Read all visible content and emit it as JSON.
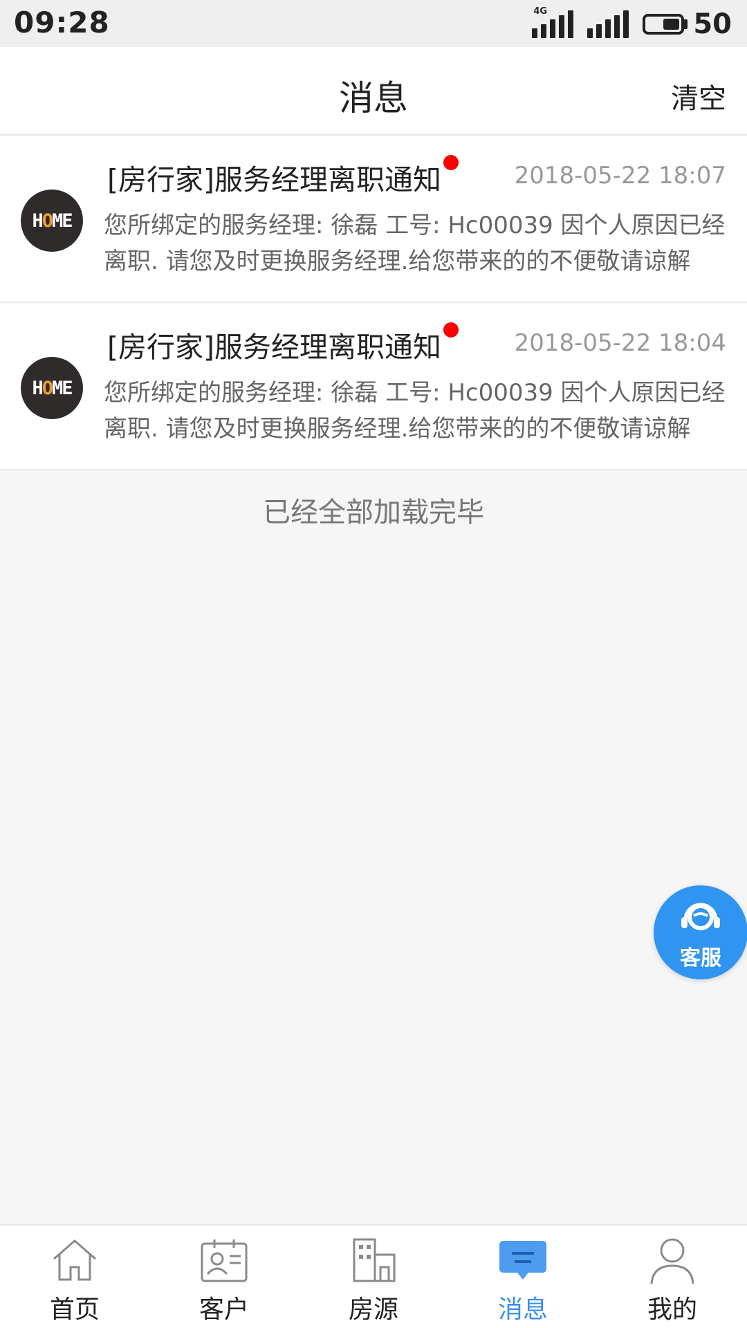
{
  "status_bar": {
    "time": "09:28",
    "network": "4G",
    "battery": "50"
  },
  "header": {
    "title": "消息",
    "clear_label": "清空"
  },
  "messages": [
    {
      "title": "[房行家]服务经理离职通知",
      "time": "2018-05-22 18:07",
      "body": "您所绑定的服务经理: 徐磊 工号: Hc00039 因个人原因已经离职. 请您及时更换服务经理.给您带来的的不便敬请谅解",
      "unread": true,
      "avatar_text": "HOME"
    },
    {
      "title": "[房行家]服务经理离职通知",
      "time": "2018-05-22 18:04",
      "body": "您所绑定的服务经理: 徐磊 工号: Hc00039 因个人原因已经离职. 请您及时更换服务经理.给您带来的的不便敬请谅解",
      "unread": true,
      "avatar_text": "HOME"
    }
  ],
  "list_footer": "已经全部加载完毕",
  "service_button": {
    "label": "客服",
    "icon": "headset-icon"
  },
  "bottom_nav": {
    "active": "消息",
    "active_color": "#3a8fe8",
    "tabs": [
      {
        "label": "首页",
        "icon": "home-icon"
      },
      {
        "label": "客户",
        "icon": "contact-card-icon"
      },
      {
        "label": "房源",
        "icon": "building-icon"
      },
      {
        "label": "消息",
        "icon": "message-icon"
      },
      {
        "label": "我的",
        "icon": "user-icon"
      }
    ]
  }
}
